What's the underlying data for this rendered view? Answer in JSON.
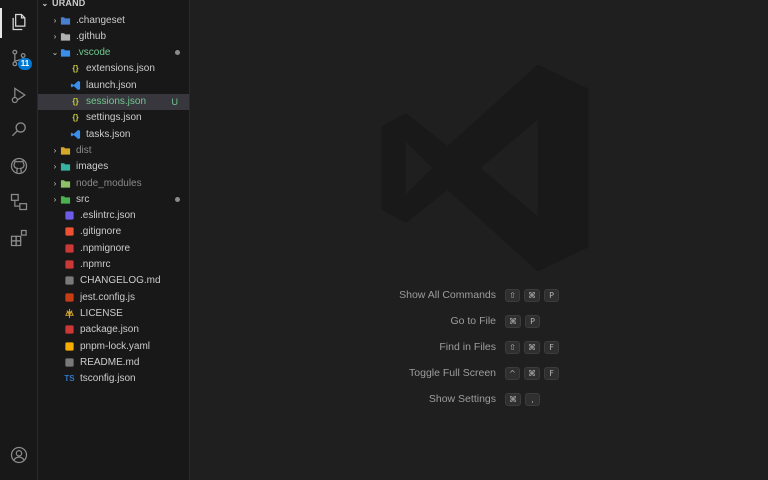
{
  "sidebar": {
    "header": "URAND",
    "items": [
      {
        "label": ".changeset",
        "type": "folder",
        "icon": "folder-changeset-icon",
        "color": "#4a7fcf"
      },
      {
        "label": ".github",
        "type": "folder",
        "icon": "folder-github-icon",
        "color": "#b0b0b0"
      },
      {
        "label": ".vscode",
        "type": "folder-open",
        "icon": "folder-vscode-icon",
        "color": "#3b8eea",
        "status": "dot",
        "modified": true
      },
      {
        "label": "extensions.json",
        "type": "file",
        "icon": "json-braces-icon",
        "color": "#cbcb41",
        "glyph": "{}"
      },
      {
        "label": "launch.json",
        "type": "file",
        "icon": "vscode-logo-icon",
        "color": "#3b8eea"
      },
      {
        "label": "sessions.json",
        "type": "file",
        "icon": "json-braces-icon",
        "color": "#cbcb41",
        "glyph": "{}",
        "status": "U",
        "selected": true,
        "modified": true
      },
      {
        "label": "settings.json",
        "type": "file",
        "icon": "json-braces-icon",
        "color": "#cbcb41",
        "glyph": "{}"
      },
      {
        "label": "tasks.json",
        "type": "file",
        "icon": "vscode-logo-icon",
        "color": "#3b8eea"
      },
      {
        "label": "dist",
        "type": "folder",
        "icon": "folder-dist-icon",
        "color": "#d4a72c",
        "dim": true
      },
      {
        "label": "images",
        "type": "folder",
        "icon": "folder-images-icon",
        "color": "#38b2a0"
      },
      {
        "label": "node_modules",
        "type": "folder",
        "icon": "folder-node-icon",
        "color": "#8cc265",
        "dim": true
      },
      {
        "label": "src",
        "type": "folder",
        "icon": "folder-src-icon",
        "color": "#4caf50",
        "status": "dot"
      },
      {
        "label": ".eslintrc.json",
        "type": "file",
        "icon": "eslint-icon",
        "color": "#6c5ce7"
      },
      {
        "label": ".gitignore",
        "type": "file",
        "icon": "git-icon",
        "color": "#f05133"
      },
      {
        "label": ".npmignore",
        "type": "file",
        "icon": "npm-icon",
        "color": "#cb3837"
      },
      {
        "label": ".npmrc",
        "type": "file",
        "icon": "npm-icon",
        "color": "#cb3837"
      },
      {
        "label": "CHANGELOG.md",
        "type": "file",
        "icon": "changelog-icon",
        "color": "#7a7a7a"
      },
      {
        "label": "jest.config.js",
        "type": "file",
        "icon": "jest-icon",
        "color": "#c63d14"
      },
      {
        "label": "LICENSE",
        "type": "file",
        "icon": "license-icon",
        "color": "#d4a72c"
      },
      {
        "label": "package.json",
        "type": "file",
        "icon": "npm-icon",
        "color": "#cb3837"
      },
      {
        "label": "pnpm-lock.yaml",
        "type": "file",
        "icon": "pnpm-icon",
        "color": "#f9ad00"
      },
      {
        "label": "README.md",
        "type": "file",
        "icon": "readme-icon",
        "color": "#7a7a7a"
      },
      {
        "label": "tsconfig.json",
        "type": "file",
        "icon": "typescript-icon",
        "color": "#3178c6",
        "glyph": "TS"
      }
    ]
  },
  "activity_bar": {
    "scm_badge": "11",
    "icons": [
      "explorer-icon",
      "source-control-icon",
      "run-debug-icon",
      "search-icon",
      "github-icon",
      "remote-explorer-icon",
      "extensions-icon",
      "account-icon"
    ]
  },
  "editor": {
    "shortcuts": [
      {
        "label": "Show All Commands",
        "keys": [
          "⇧",
          "⌘",
          "P"
        ]
      },
      {
        "label": "Go to File",
        "keys": [
          "⌘",
          "P"
        ]
      },
      {
        "label": "Find in Files",
        "keys": [
          "⇧",
          "⌘",
          "F"
        ]
      },
      {
        "label": "Toggle Full Screen",
        "keys": [
          "^",
          "⌘",
          "F"
        ]
      },
      {
        "label": "Show Settings",
        "keys": [
          "⌘",
          ","
        ]
      }
    ]
  },
  "colors": {
    "accent": "#0078d4",
    "modified": "#73c991",
    "background": "#1f1f1f",
    "sidebar": "#181818"
  }
}
